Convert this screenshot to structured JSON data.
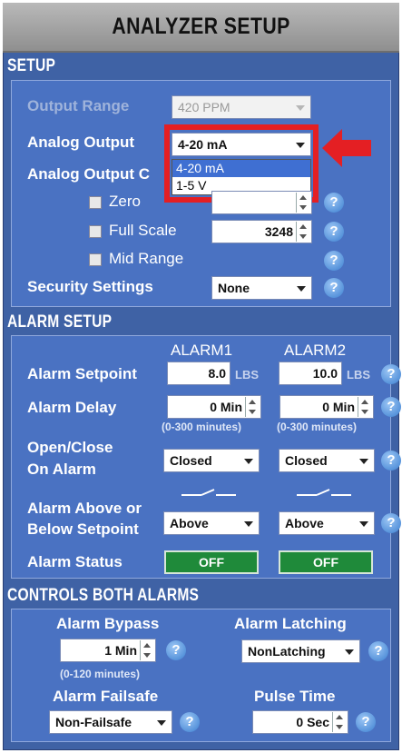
{
  "title": "ANALYZER SETUP",
  "setup": {
    "header": "SETUP",
    "output_range": {
      "label": "Output Range",
      "value": "420 PPM"
    },
    "analog_output": {
      "label": "Analog Output",
      "value": "4-20 mA",
      "options": [
        "4-20 mA",
        "1-5 V"
      ]
    },
    "analog_output_cal": {
      "label": "Analog Output C"
    },
    "zero": {
      "label": "Zero",
      "value": ""
    },
    "full_scale": {
      "label": "Full Scale",
      "value": "3248"
    },
    "mid_range": {
      "label": "Mid Range"
    },
    "security": {
      "label": "Security Settings",
      "value": "None"
    }
  },
  "alarm_setup": {
    "header": "ALARM SETUP",
    "col1": "ALARM1",
    "col2": "ALARM2",
    "setpoint": {
      "label": "Alarm Setpoint",
      "a1": "8.0",
      "a2": "10.0",
      "unit": "LBS"
    },
    "delay": {
      "label": "Alarm Delay",
      "a1": "0 Min",
      "a2": "0 Min",
      "hint": "(0-300 minutes)"
    },
    "open_close": {
      "label_line1": "Open/Close",
      "label_line2": "On Alarm",
      "a1": "Closed",
      "a2": "Closed"
    },
    "above_below": {
      "label_line1": "Alarm Above or",
      "label_line2": "Below Setpoint",
      "a1": "Above",
      "a2": "Above"
    },
    "status": {
      "label": "Alarm Status",
      "a1": "OFF",
      "a2": "OFF"
    }
  },
  "controls": {
    "header": "CONTROLS BOTH ALARMS",
    "bypass": {
      "label": "Alarm Bypass",
      "value": "1 Min",
      "hint": "(0-120 minutes)"
    },
    "latching": {
      "label": "Alarm Latching",
      "value": "NonLatching"
    },
    "failsafe": {
      "label": "Alarm Failsafe",
      "value": "Non-Failsafe"
    },
    "pulse": {
      "label": "Pulse Time",
      "value": "0 Sec"
    }
  },
  "help_glyph": "?",
  "colors": {
    "panel": "#4a72c2",
    "frame": "#3f62a5",
    "status_off": "#1f8a3a",
    "highlight": "#e41f23"
  }
}
